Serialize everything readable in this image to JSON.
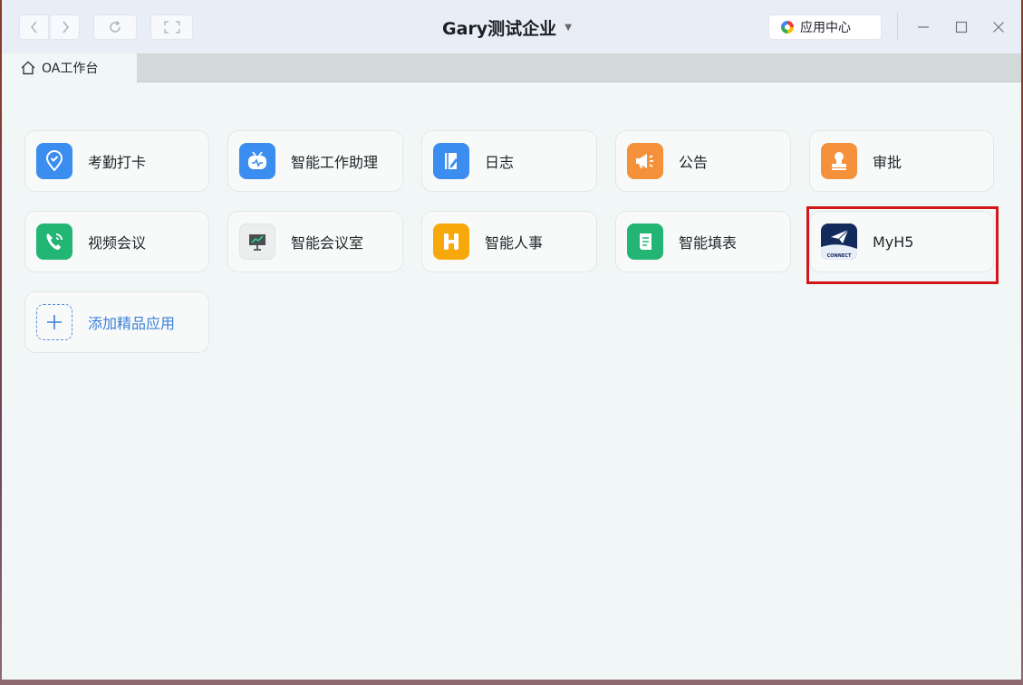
{
  "titlebar": {
    "title": "Gary测试企业",
    "app_center_label": "应用中心"
  },
  "tabs": [
    {
      "label": "OA工作台",
      "active": true
    }
  ],
  "apps": [
    {
      "label": "考勤打卡",
      "icon": "location-check-icon",
      "color": "#3b8df0"
    },
    {
      "label": "智能工作助理",
      "icon": "robot-tv-icon",
      "color": "#3b8df0"
    },
    {
      "label": "日志",
      "icon": "notebook-pen-icon",
      "color": "#3b8df0"
    },
    {
      "label": "公告",
      "icon": "megaphone-icon",
      "color": "#f4913a"
    },
    {
      "label": "审批",
      "icon": "stamp-icon",
      "color": "#f4913a"
    },
    {
      "label": "视频会议",
      "icon": "video-call-icon",
      "color": "#22b573"
    },
    {
      "label": "智能会议室",
      "icon": "presentation-board-icon",
      "color": "#eceeee"
    },
    {
      "label": "智能人事",
      "icon": "hr-h-icon",
      "color": "#f7a90c"
    },
    {
      "label": "智能填表",
      "icon": "form-list-icon",
      "color": "#22b573"
    },
    {
      "label": "MyH5",
      "icon": "paper-plane-connect-icon",
      "color": "#132a5c",
      "icon_caption": "CONNECT"
    }
  ],
  "add_app": {
    "label": "添加精品应用",
    "icon": "plus-icon"
  },
  "colors": {
    "accent": "#3a7fd8",
    "highlight_border": "#d2161b"
  }
}
